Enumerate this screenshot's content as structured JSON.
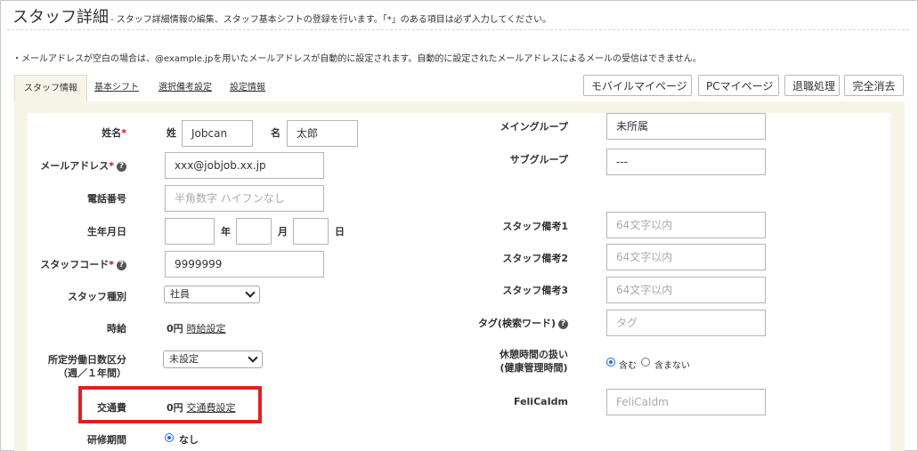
{
  "header": {
    "title": "スタッフ詳細",
    "subtitle": "- スタッフ詳細情報の編集、スタッフ基本シフトの登録を行います。「*」のある項目は必ず入力してください。"
  },
  "notice": "・メールアドレスが空白の場合は、@example.jpを用いたメールアドレスが自動的に設定されます。自動的に設定されたメールアドレスによるメールの受信はできません。",
  "tabs": [
    {
      "label": "スタッフ情報",
      "active": true
    },
    {
      "label": "基本シフト",
      "active": false
    },
    {
      "label": "選択備考設定",
      "active": false
    },
    {
      "label": "設定情報",
      "active": false
    }
  ],
  "actions": {
    "mobile_mypage": "モバイルマイページ",
    "pc_mypage": "PCマイページ",
    "retire": "退職処理",
    "delete_all": "完全消去"
  },
  "form": {
    "name": {
      "label": "姓名",
      "req": "*",
      "sei_label": "姓",
      "sei_value": "Jobcan",
      "mei_label": "名",
      "mei_value": "太郎"
    },
    "email": {
      "label": "メールアドレス",
      "req": "*",
      "value": "xxx@jobjob.xx.jp"
    },
    "phone": {
      "label": "電話番号",
      "placeholder": "半角数字 ハイフンなし"
    },
    "birthday": {
      "label": "生年月日",
      "year": "年",
      "month": "月",
      "day": "日"
    },
    "staff_code": {
      "label": "スタッフコード",
      "req": "*",
      "value": "9999999"
    },
    "staff_type": {
      "label": "スタッフ種別",
      "selected": "社員"
    },
    "hourly": {
      "label": "時給",
      "amount": "0円",
      "link": "時給設定"
    },
    "workdays": {
      "label_line1": "所定労働日数区分",
      "label_line2": "（週／１年間）",
      "selected": "未設定"
    },
    "transport": {
      "label": "交通費",
      "amount": "0円",
      "link": "交通費設定"
    },
    "training": {
      "label": "研修期間",
      "option": "なし"
    },
    "main_group": {
      "label": "メイングループ",
      "value": "未所属"
    },
    "sub_group": {
      "label": "サブグループ",
      "value": "---"
    },
    "note1": {
      "label": "スタッフ備考1",
      "placeholder": "64文字以内"
    },
    "note2": {
      "label": "スタッフ備考2",
      "placeholder": "64文字以内"
    },
    "note3": {
      "label": "スタッフ備考3",
      "placeholder": "64文字以内"
    },
    "tag": {
      "label": "タグ(検索ワード)",
      "placeholder": "タグ"
    },
    "break": {
      "label_line1": "休憩時間の扱い",
      "label_line2": "(健康管理時間)",
      "option_include": "含む",
      "option_exclude": "含まない"
    },
    "felica": {
      "label": "FeliCaIdm",
      "placeholder": "FeliCaIdm"
    }
  },
  "colors": {
    "panel_bg": "#f7f4e8",
    "required": "#d0021b",
    "highlight": "#e02020",
    "radio": "#1a6fe0"
  },
  "icons": {
    "help": "question-circle-icon",
    "dropdown": "chevron-down-icon"
  }
}
